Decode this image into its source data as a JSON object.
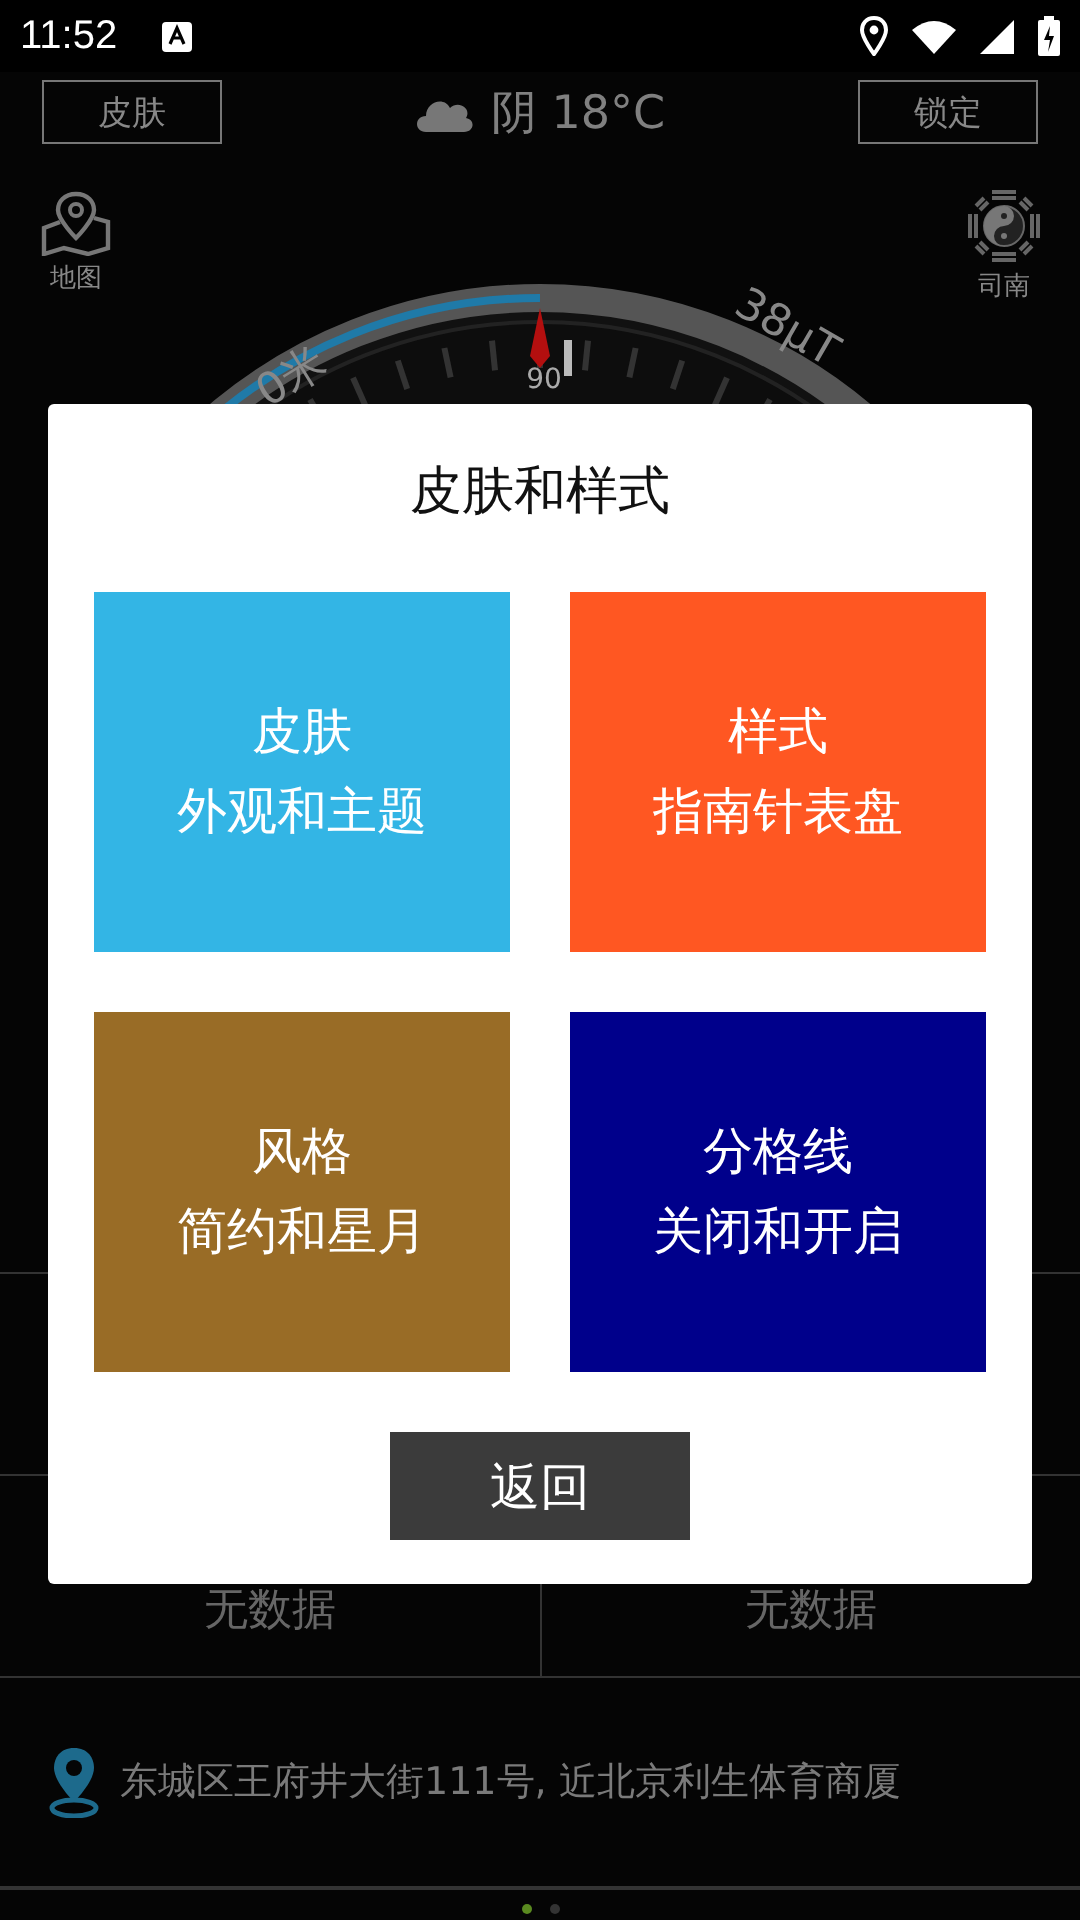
{
  "status_bar": {
    "time": "11:52"
  },
  "top_bar": {
    "skin_button": "皮肤",
    "weather": "阴 18°C",
    "lock_button": "锁定"
  },
  "side_buttons": [
    {
      "kind": "map",
      "label": "地图"
    },
    {
      "kind": "taiji",
      "label": "司南"
    }
  ],
  "compass": {
    "distance": "0米",
    "magnetic": "38μT",
    "heading": "90"
  },
  "dialog": {
    "title": "皮肤和样式",
    "tiles": [
      {
        "title": "皮肤",
        "subtitle": "外观和主题",
        "color": "#33b5e5"
      },
      {
        "title": "样式",
        "subtitle": "指南针表盘",
        "color": "#ff5722"
      },
      {
        "title": "风格",
        "subtitle": "简约和星月",
        "color": "#996c26"
      },
      {
        "title": "分格线",
        "subtitle": "关闭和开启",
        "color": "#00008b"
      }
    ],
    "back_button": "返回"
  },
  "readings": [
    "无数据",
    "无数据"
  ],
  "address": "东城区王府井大街111号, 近北京利生体育商厦",
  "pager": [
    {
      "selected": true
    },
    {
      "selected": false
    }
  ]
}
